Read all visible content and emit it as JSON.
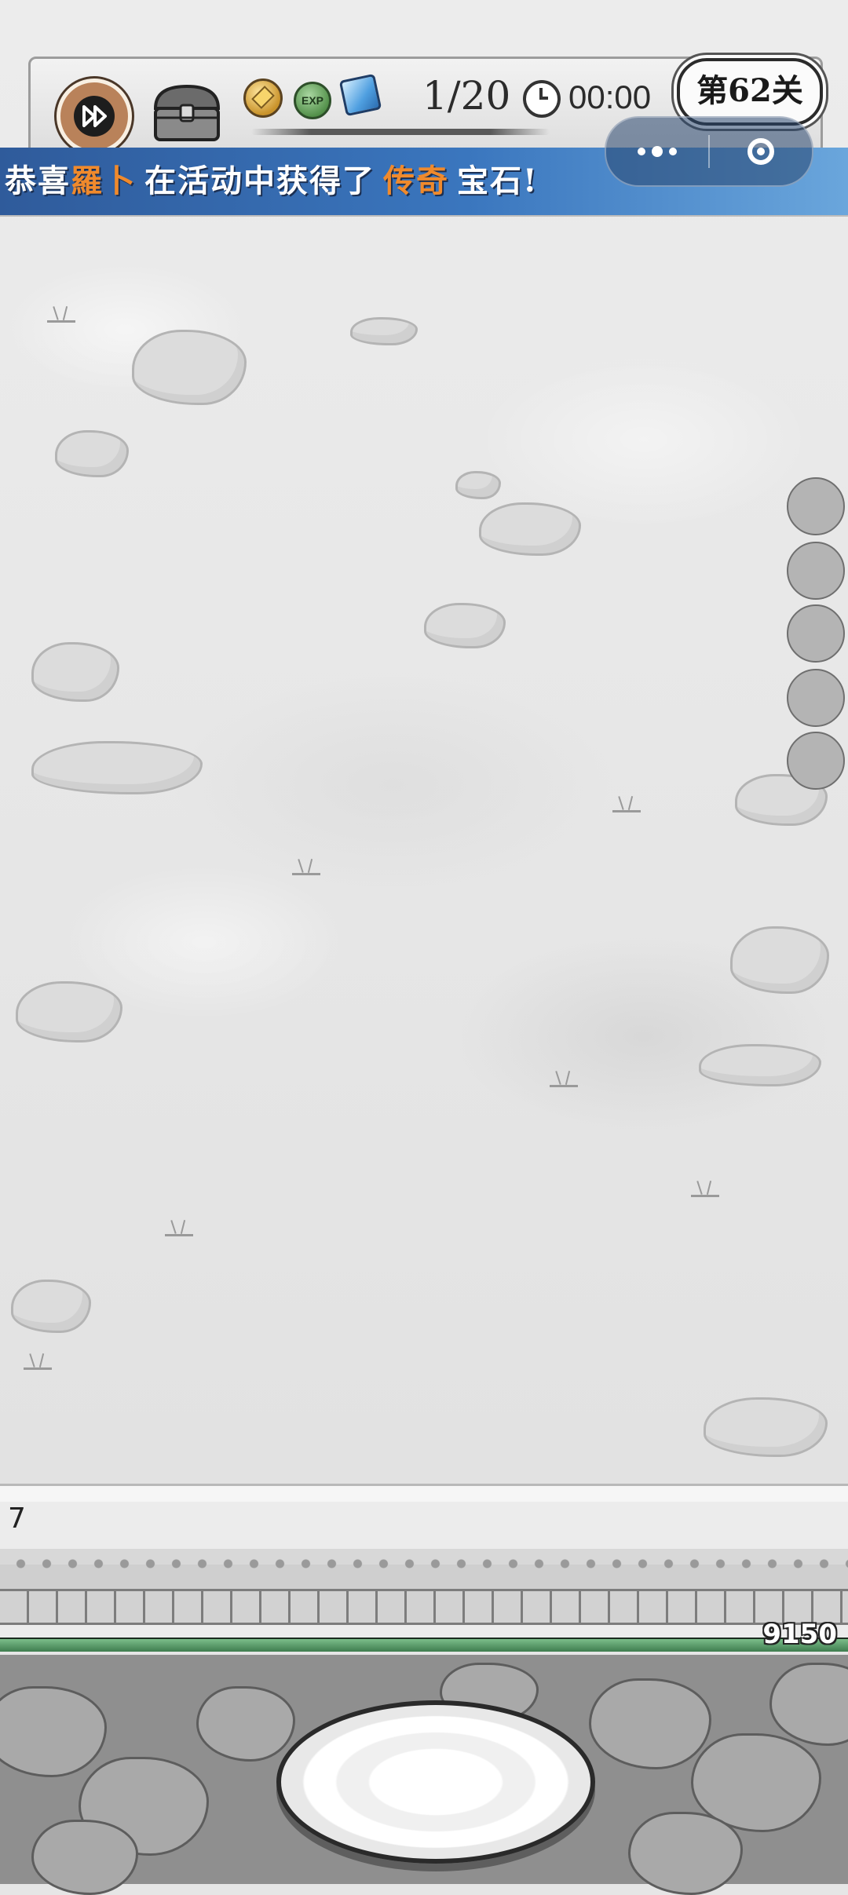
{
  "hud": {
    "wave": "1/20",
    "timer": "00:00",
    "level": "第62关",
    "icons": [
      "speed-up-icon",
      "treasure-chest-icon",
      "gold-coin-icon",
      "exp-icon",
      "blue-gem-icon",
      "clock-icon"
    ],
    "exp_label": "EXP"
  },
  "banner": {
    "prefix": "恭喜",
    "player": "羅卜",
    "middle": "在活动中获得了",
    "rarity": "传奇",
    "suffix": "宝石!"
  },
  "capsule": {
    "icons": [
      "more-dots-icon",
      "close-target-icon"
    ]
  },
  "wall": {
    "count": "7",
    "hp": "9150",
    "hp_fraction": 1.0
  },
  "colors": {
    "banner": "#3a76be",
    "highlight": "#f08a2c",
    "hp": "#3f7d4f"
  }
}
